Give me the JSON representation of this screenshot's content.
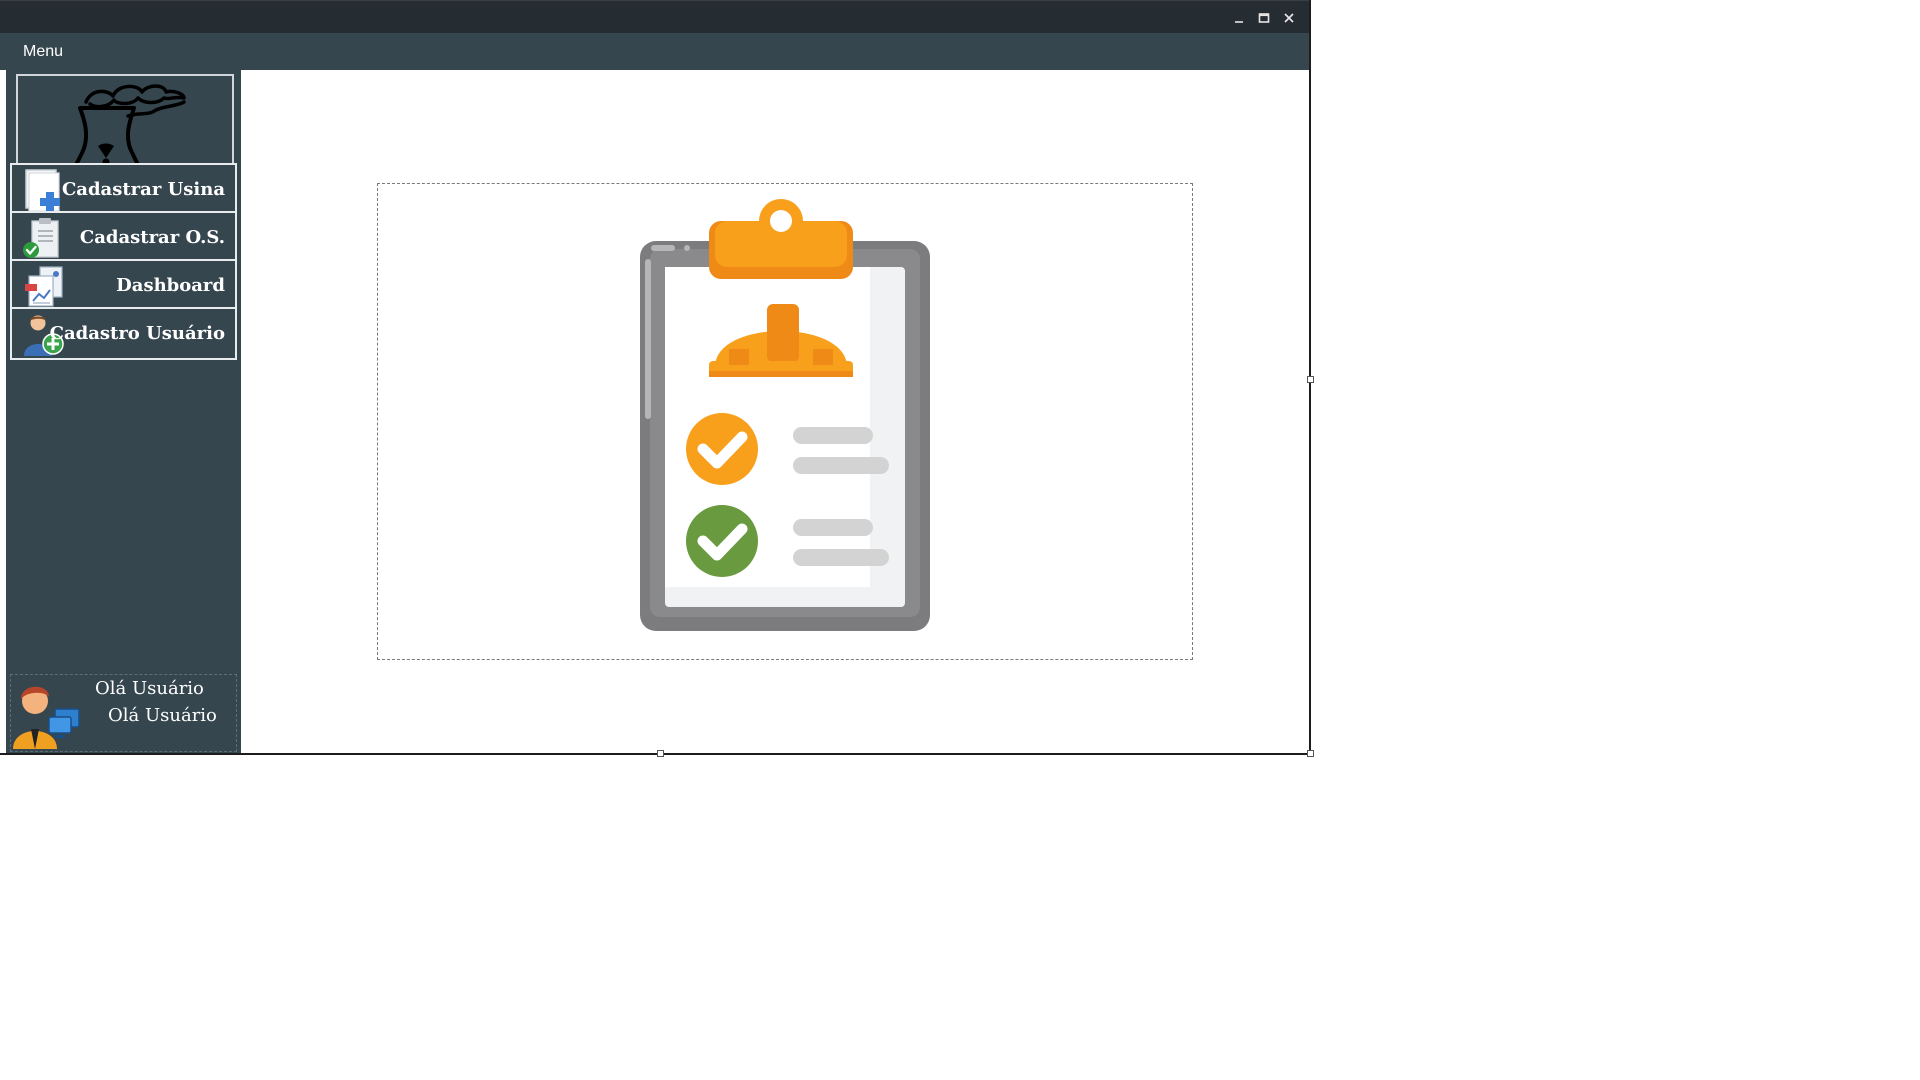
{
  "window": {
    "controls": {
      "minimize_icon": "minimize-icon",
      "maximize_icon": "maximize-icon",
      "close_icon": "close-icon"
    }
  },
  "menubar": {
    "menu_label": "Menu"
  },
  "sidebar": {
    "logo_icon": "nuclear-plant-icon",
    "items": [
      {
        "label": "Cadastrar Usina",
        "icon": "add-document-icon"
      },
      {
        "label": "Cadastrar O.S.",
        "icon": "clipboard-check-icon"
      },
      {
        "label": "Dashboard",
        "icon": "report-icon"
      },
      {
        "label": "Cadastro Usuário",
        "icon": "add-user-icon"
      }
    ],
    "user": {
      "line1": "Olá Usuário",
      "line2": "Olá Usuário",
      "avatar_icon": "user-computer-icon"
    }
  },
  "main": {
    "illustration": "safety-checklist-clipboard",
    "colors": {
      "clipboard_frame": "#7c7c7f",
      "hard_hat": "#f89f1b",
      "check_orange": "#f89f1b",
      "check_green": "#6a9a3f",
      "lines": "#d3d3d3"
    }
  },
  "colors": {
    "titlebar": "#252c32",
    "menubar": "#36464f",
    "sidebar": "#36464f",
    "content_bg": "#ffffff"
  }
}
